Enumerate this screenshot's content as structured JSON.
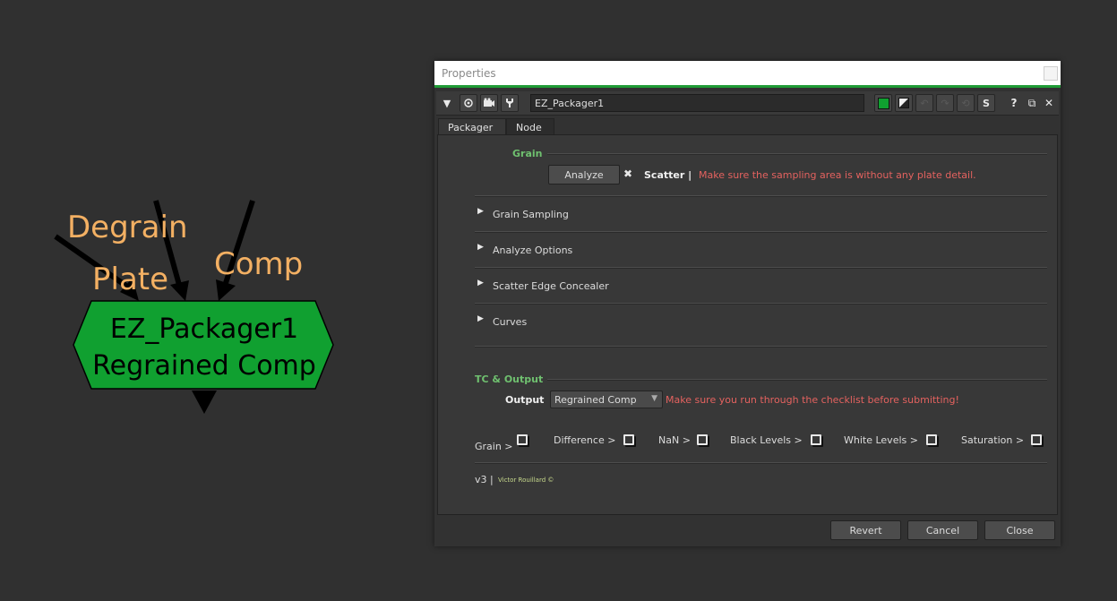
{
  "node_graph": {
    "inputs": [
      "Degrain",
      "Plate",
      "Comp"
    ],
    "node_name": "EZ_Packager1",
    "node_label": "Regrained Comp",
    "node_color": "#10a030",
    "label_color": "#f3b063"
  },
  "properties": {
    "window_title": "Properties",
    "node_name_value": "EZ_Packager1",
    "toolbar_icons": [
      "collapse-arrow-icon",
      "center-node-icon",
      "viewer-icon",
      "wrench-icon",
      "node-color-swatch",
      "font-color-swatch",
      "undo-icon",
      "redo-icon",
      "revert-icon",
      "s-icon",
      "help-icon",
      "float-icon",
      "close-icon"
    ],
    "toolbar": {
      "help": "?",
      "float": "⧉",
      "close": "✕",
      "s": "S"
    },
    "tabs": [
      {
        "label": "Packager",
        "active": true
      },
      {
        "label": "Node",
        "active": false
      }
    ],
    "grain": {
      "title": "Grain",
      "analyze_button": "Analyze",
      "status": "Scatter |",
      "warning": "Make sure the sampling area is without any plate detail."
    },
    "groups": [
      "Grain Sampling",
      "Analyze Options",
      "Scatter Edge Concealer",
      "Curves"
    ],
    "output_section": {
      "title": "TC & Output",
      "output_label": "Output",
      "output_value": "Regrained Comp",
      "warning": "Make sure you run through the checklist before submitting!"
    },
    "checklist": [
      {
        "label": "Grain >",
        "checked": false
      },
      {
        "label": "Difference >",
        "checked": false
      },
      {
        "label": "NaN >",
        "checked": false
      },
      {
        "label": "Black Levels >",
        "checked": false
      },
      {
        "label": "White Levels >",
        "checked": false
      },
      {
        "label": "Saturation >",
        "checked": false
      }
    ],
    "footer": {
      "version": "v3 |",
      "author": "Victor Rouillard ©"
    },
    "buttons": {
      "revert": "Revert",
      "cancel": "Cancel",
      "close": "Close"
    }
  }
}
